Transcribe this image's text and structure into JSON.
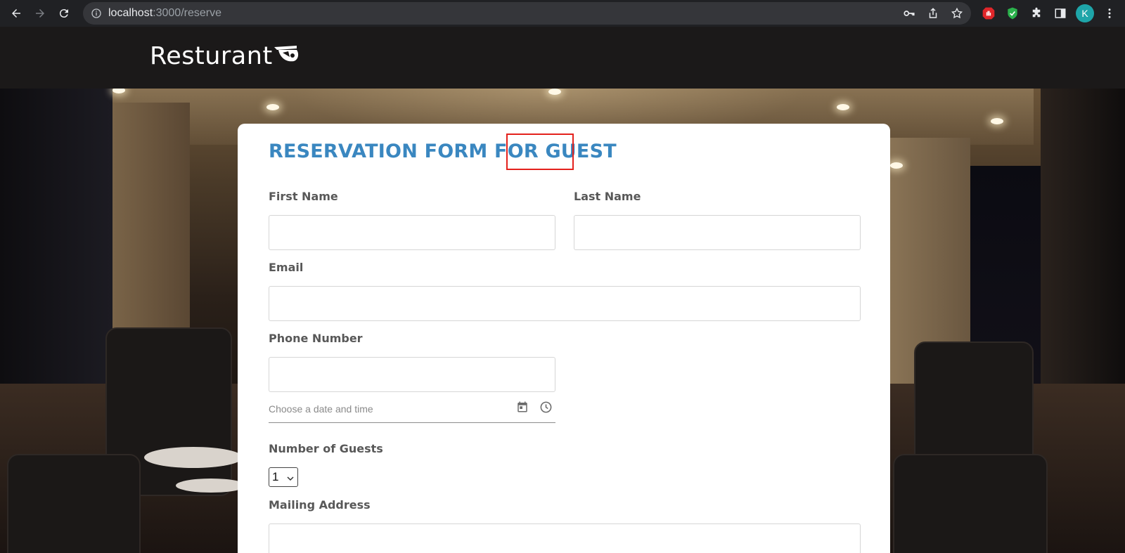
{
  "browser": {
    "url_host": "localhost",
    "url_rest": ":3000/reserve",
    "profile_initial": "K"
  },
  "site": {
    "logo_text": "Resturant"
  },
  "form": {
    "title_prefix": "RESERVATION FORM FOR ",
    "title_highlight": "GUEST",
    "first_name_label": "First Name",
    "last_name_label": "Last Name",
    "email_label": "Email",
    "phone_label": "Phone Number",
    "datetime_placeholder": "Choose a date and time",
    "guests_label": "Number of Guests",
    "guests_value": "1",
    "address_label": "Mailing Address",
    "title_color": "#3a87c0",
    "highlight_color": "#e4211c"
  }
}
